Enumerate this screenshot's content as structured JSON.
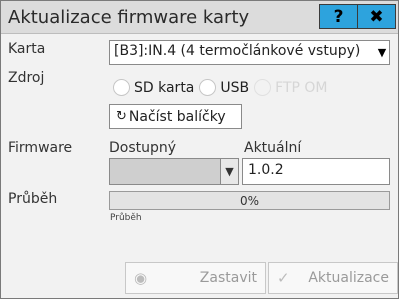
{
  "window": {
    "title": "Aktualizace firmware karty",
    "help_label": "?",
    "close_label": "✖"
  },
  "card": {
    "label": "Karta",
    "selected": "[B3]:IN.4 (4 termočlánkové vstupy)"
  },
  "source": {
    "label": "Zdroj",
    "options": [
      {
        "label": "SD karta",
        "enabled": true
      },
      {
        "label": "USB",
        "enabled": true
      },
      {
        "label": "FTP OM",
        "enabled": false
      }
    ]
  },
  "load_button": {
    "icon": "refresh-icon",
    "label": "Načíst balíčky"
  },
  "firmware": {
    "label": "Firmware",
    "available_label": "Dostupný",
    "current_label": "Aktuální",
    "current_value": "1.0.2"
  },
  "progress": {
    "label": "Průběh",
    "value_text": "0%",
    "percent": 0,
    "sub_label": "Průběh"
  },
  "actions": {
    "stop_label": "Zastavit",
    "update_label": "Aktualizace"
  },
  "colors": {
    "accent": "#2da3dd",
    "titlebar": "#dcdcdc"
  }
}
